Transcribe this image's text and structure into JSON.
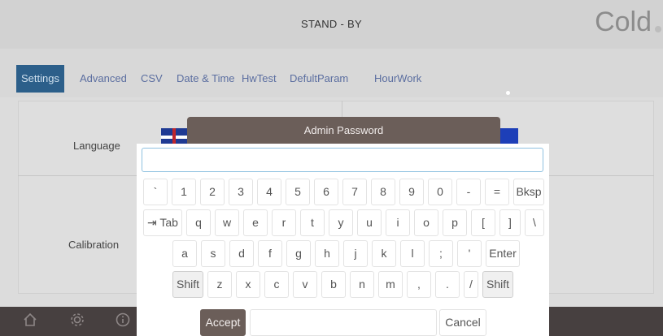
{
  "header": {
    "status": "STAND - BY",
    "mode": "Cold"
  },
  "tabs": [
    "Settings",
    "Advanced",
    "CSV",
    "Date & Time",
    "HwTest",
    "DefultParam",
    "HourWork"
  ],
  "settings": {
    "language_label": "Language",
    "calibration_label": "Calibration"
  },
  "dialog": {
    "title": "Admin Password",
    "password_value": ""
  },
  "keyboard": {
    "row1": [
      "`",
      "1",
      "2",
      "3",
      "4",
      "5",
      "6",
      "7",
      "8",
      "9",
      "0",
      "-",
      "=",
      "Bksp"
    ],
    "row2": [
      "⇥ Tab",
      "q",
      "w",
      "e",
      "r",
      "t",
      "y",
      "u",
      "i",
      "o",
      "p",
      "[",
      "]",
      "\\"
    ],
    "row3": [
      "a",
      "s",
      "d",
      "f",
      "g",
      "h",
      "j",
      "k",
      "l",
      ";",
      "'",
      "Enter"
    ],
    "row4": [
      "Shift",
      "z",
      "x",
      "c",
      "v",
      "b",
      "n",
      "m",
      ",",
      ".",
      "/",
      "Shift"
    ],
    "accept": "Accept",
    "cancel": "Cancel"
  },
  "icons": {
    "home": "home-icon",
    "settings": "gear-icon",
    "info": "info-icon"
  },
  "colors": {
    "active_tab": "#2c5f8a",
    "dialog_header": "#6b5e59",
    "bottom_bar": "#474040"
  }
}
